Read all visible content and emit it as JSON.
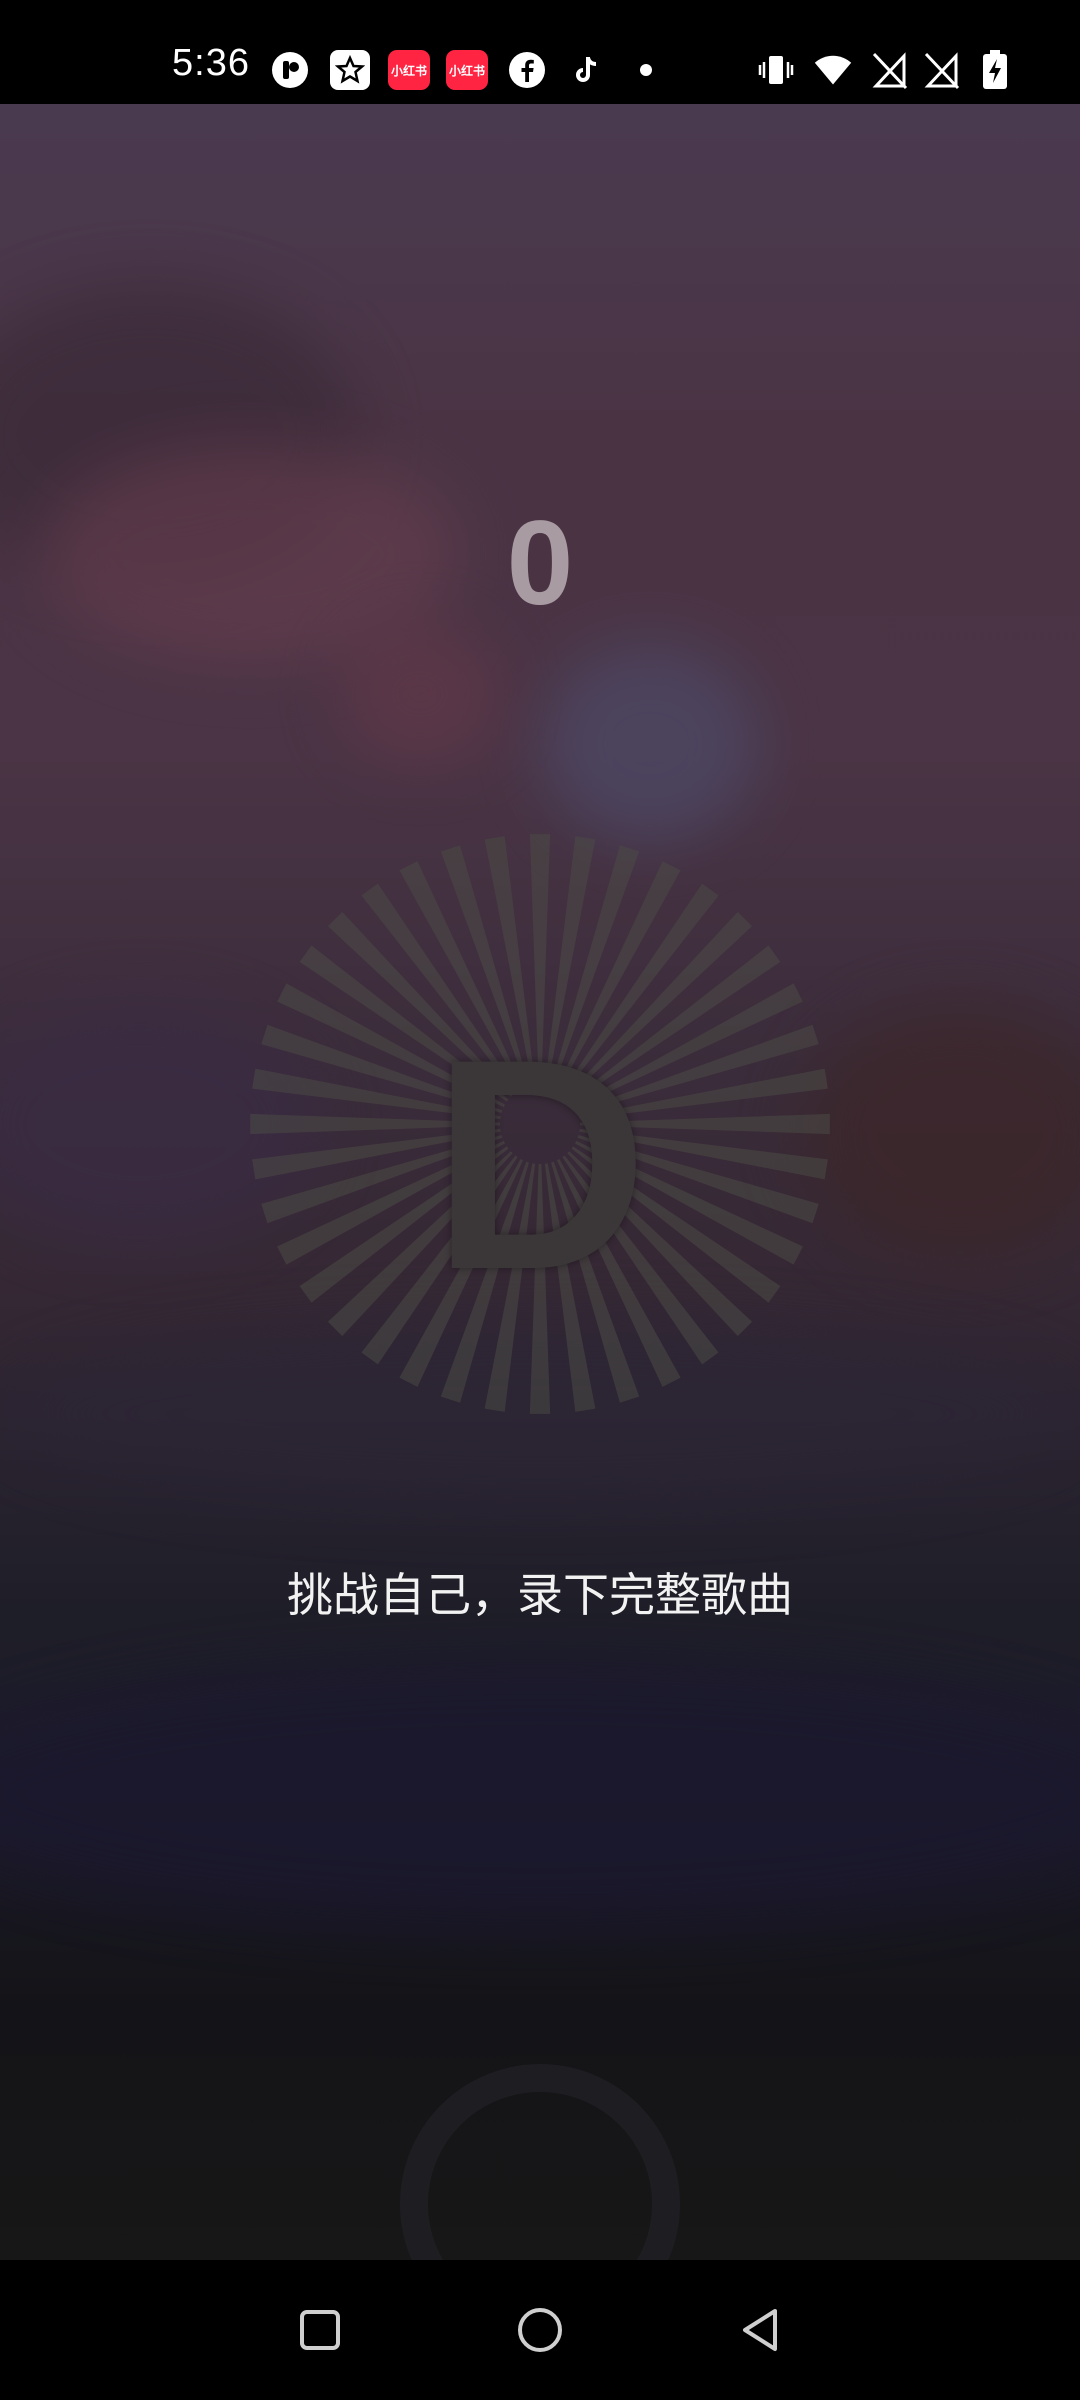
{
  "status_bar": {
    "time": "5:36",
    "app_badge_label": "小红书",
    "icons": [
      "threads-icon",
      "starred-app-icon",
      "xiaohongshu-icon",
      "xiaohongshu-icon",
      "facebook-icon",
      "tiktok-icon",
      "notification-dot-icon",
      "vibrate-icon",
      "wifi-icon",
      "no-sim-icon",
      "no-sim-icon",
      "battery-charging-icon"
    ]
  },
  "game": {
    "score": "0",
    "grade": "D",
    "prompt": "挑战自己，录下完整歌曲"
  },
  "nav_bar": {
    "icons": [
      "recents-button",
      "home-button",
      "back-button"
    ]
  },
  "colors": {
    "score": "#a89ba2",
    "grade": "#3b3638",
    "prompt": "#f2f2f2",
    "badge_red": "#ff2442"
  }
}
